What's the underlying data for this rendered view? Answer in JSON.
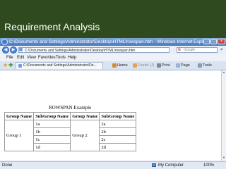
{
  "slide": {
    "title": "Requirement Analysis",
    "banner_color": "#2e4a1e"
  },
  "browser": {
    "window_title": "C:\\Documents and Settings\\Administrator\\Desktop\\HTML\\rowspan.htm - Windows Internet Explorer",
    "address": "C:\\Documents and Settings\\Administrator\\Desktop\\HTML\\rowspan.htm",
    "search_placeholder": "Google",
    "search_brand": "G",
    "menu": [
      "File",
      "Edit",
      "View",
      "Favorites",
      "Tools",
      "Help"
    ],
    "tab_title": "C:\\Documents and Settings\\Administrator\\De...",
    "toolbar": {
      "home": "Home",
      "feeds": "Feeds (J)",
      "print": "Print",
      "page": "Page",
      "tools": "Tools"
    },
    "icons": {
      "back": "back-arrow-icon",
      "forward": "forward-arrow-icon",
      "favorites": "star-icon",
      "search": "magnifier-icon"
    },
    "status": {
      "left": "Done",
      "zone": "My Computer",
      "zoom": "100%"
    }
  },
  "page": {
    "caption": "ROWSPAN Example",
    "headers": [
      "Group Name",
      "SubGroup Name",
      "Group Name",
      "SubGroup Name"
    ],
    "group1": "Group 1",
    "group2": "Group 2",
    "rows": [
      {
        "sub1": "1a",
        "sub2": "2a"
      },
      {
        "sub1": "1b",
        "sub2": "2b"
      },
      {
        "sub1": "1c",
        "sub2": "2c"
      },
      {
        "sub1": "1d",
        "sub2": "2d"
      }
    ]
  }
}
